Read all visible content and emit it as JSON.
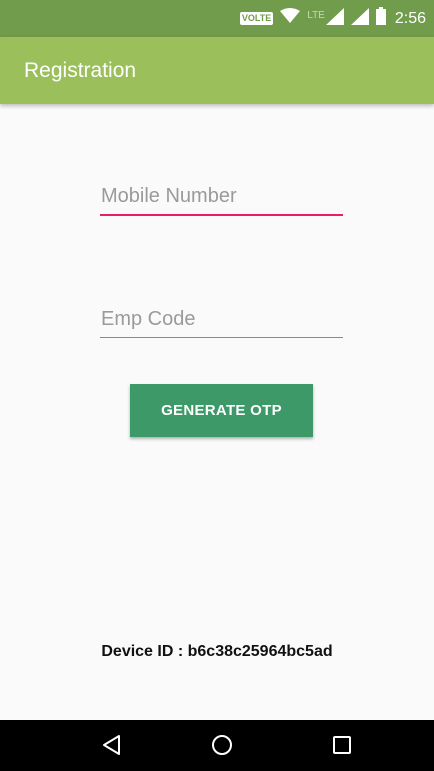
{
  "status_bar": {
    "volte_label": "VOLTE",
    "network_label": "LTE",
    "time": "2:56",
    "icons": [
      "volte-icon",
      "wifi-icon",
      "signal-icon",
      "signal-icon",
      "battery-icon"
    ]
  },
  "app_bar": {
    "title": "Registration"
  },
  "form": {
    "mobile_placeholder": "Mobile Number",
    "mobile_value": "",
    "emp_placeholder": "Emp Code",
    "emp_value": "",
    "otp_button_label": "GENERATE OTP"
  },
  "footer": {
    "device_id": "Device ID : b6c38c25964bc5ad"
  },
  "nav_bar": {
    "icons": [
      "back-icon",
      "home-icon",
      "recents-icon"
    ]
  },
  "colors": {
    "status_bar": "#719c4b",
    "app_bar": "#9bbf5a",
    "accent": "#e91e63",
    "button": "#3d9a68",
    "background": "#fafafa"
  }
}
